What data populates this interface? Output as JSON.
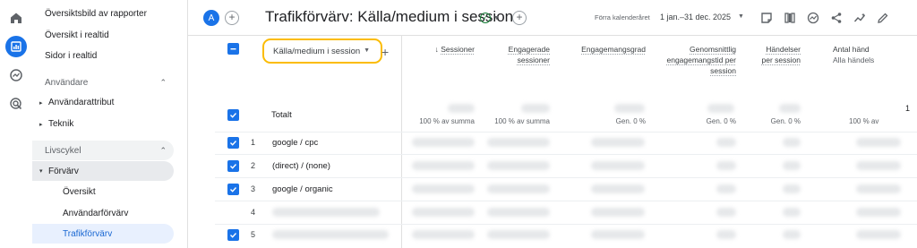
{
  "rail": {
    "icons": [
      "home-icon",
      "reports-icon",
      "explore-icon",
      "advertising-icon"
    ]
  },
  "sidebar": {
    "links": [
      "Översiktsbild av rapporter",
      "Översikt i realtid",
      "Sidor i realtid"
    ],
    "section_users": "Användare",
    "user_items": [
      "Användarattribut",
      "Teknik"
    ],
    "section_lifecycle": "Livscykel",
    "acquisition": "Förvärv",
    "acquisition_children": [
      "Översikt",
      "Användarförvärv"
    ],
    "active_item": "Trafikförvärv"
  },
  "header": {
    "avatar_letter": "A",
    "add_label": "+",
    "title": "Trafikförvärv: Källa/medium i session",
    "check_glyph": "✓",
    "date_label": "Förra kalenderåret",
    "date_range": "1 jan.–31 dec. 2025"
  },
  "table": {
    "dimension_select": "Källa/medium i session",
    "add_dimension": "+",
    "columns": [
      {
        "label": "Sessioner",
        "sort": "↓",
        "sub": "100 % av summa"
      },
      {
        "label": "Engagerade sessioner",
        "sub": "100 % av summa"
      },
      {
        "label": "Engagemangsgrad",
        "sub": "Gen. 0 %"
      },
      {
        "label": "Genomsnittlig engagemangstid per session",
        "sub": "Gen. 0 %"
      },
      {
        "label": "Händelser per session",
        "sub": "Gen. 0 %"
      },
      {
        "label": "Antal händ",
        "extra": "Alla händels",
        "sub": "100 % av"
      }
    ],
    "total_label": "Totalt",
    "total_partial": "1",
    "rows": [
      {
        "index": "1",
        "name": "google / cpc",
        "checked": true
      },
      {
        "index": "2",
        "name": "(direct) / (none)",
        "checked": true
      },
      {
        "index": "3",
        "name": "google / organic",
        "checked": true
      },
      {
        "index": "4",
        "name": "",
        "checked": false
      },
      {
        "index": "5",
        "name": "",
        "checked": true
      }
    ]
  },
  "colors": {
    "accent": "#1a73e8",
    "highlight": "#fbbc04",
    "active_bg": "#e8f0fe"
  }
}
